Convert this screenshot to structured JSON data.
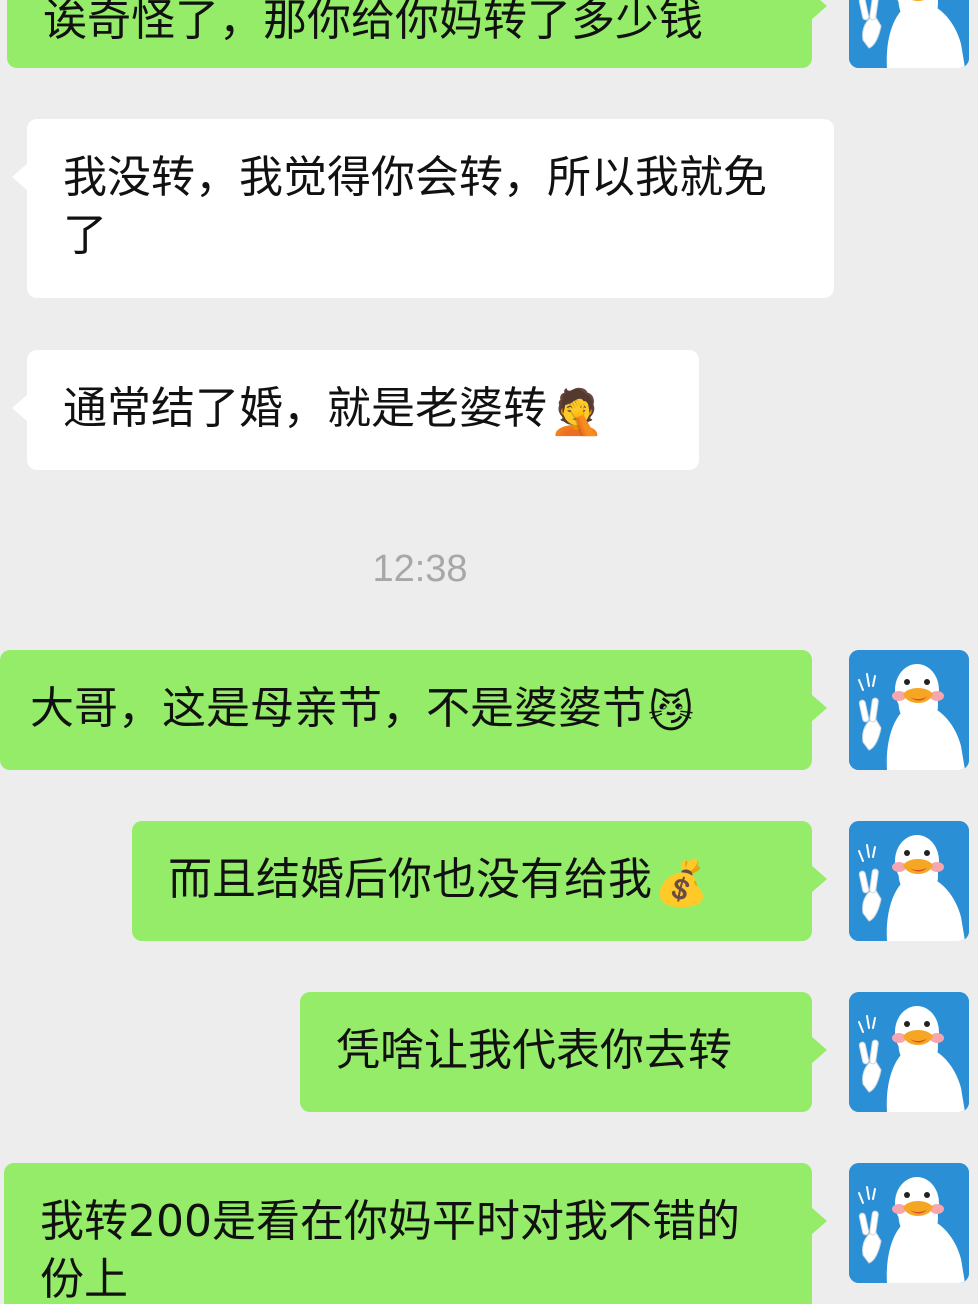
{
  "messages": [
    {
      "text": "诶奇怪了，那你给你妈转了多少钱",
      "side": "me"
    },
    {
      "text": "我没转，我觉得你会转，所以我就免了",
      "side": "other"
    },
    {
      "text": "通常结了婚，就是老婆转",
      "side": "other",
      "emoji": "🤦"
    },
    {
      "text": "大哥，这是母亲节，不是婆婆节",
      "side": "me",
      "emoji": "😼"
    },
    {
      "text": "而且结婚后你也没有给我",
      "side": "me",
      "emoji": "💰"
    },
    {
      "text": "凭啥让我代表你去转",
      "side": "me"
    },
    {
      "text": "我转200是看在你妈平时对我不错的份上",
      "side": "me"
    }
  ],
  "timestamp": "12:38",
  "colors": {
    "background": "#ededed",
    "outgoing_bubble": "#95ec69",
    "incoming_bubble": "#ffffff",
    "timestamp_text": "#a7a7a7",
    "avatar_background": "#2b8fd6"
  },
  "avatar": {
    "icon": "duck-victory-sign-icon"
  }
}
